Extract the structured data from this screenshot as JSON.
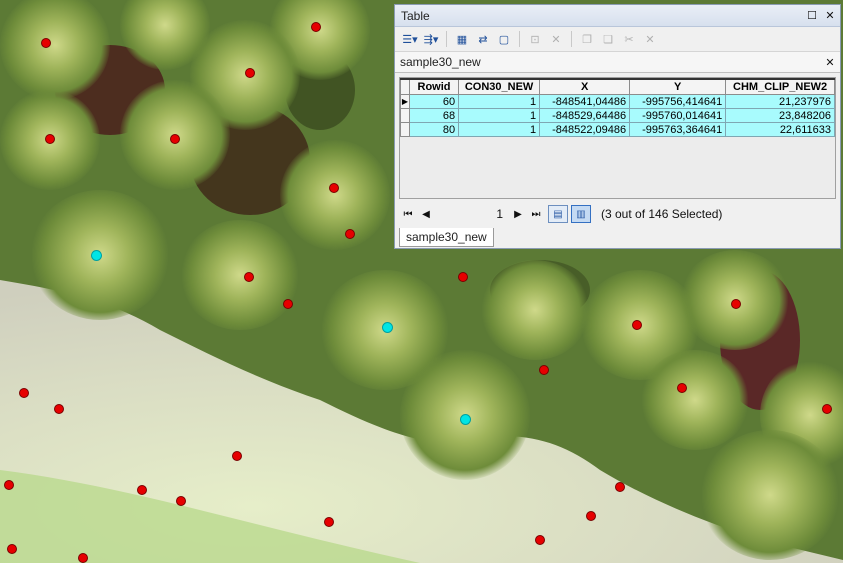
{
  "window": {
    "title": "Table",
    "pin_icon": "restore-icon",
    "close_icon": "close-icon"
  },
  "toolbar": {
    "items": [
      {
        "icon": "table-options-icon",
        "glyph": "☰▾",
        "enabled": true
      },
      {
        "icon": "related-tables-icon",
        "glyph": "⇶▾",
        "enabled": true
      },
      {
        "icon": "select-by-attributes-icon",
        "glyph": "▦",
        "enabled": true
      },
      {
        "icon": "switch-selection-icon",
        "glyph": "⇄",
        "enabled": true
      },
      {
        "icon": "clear-selection-icon",
        "glyph": "▢",
        "enabled": true
      },
      {
        "icon": "zoom-to-selected-icon",
        "glyph": "⊡",
        "enabled": false
      },
      {
        "icon": "delete-selected-icon",
        "glyph": "✕",
        "enabled": false
      },
      {
        "icon": "copy-icon",
        "glyph": "❐",
        "enabled": false
      },
      {
        "icon": "paste-icon",
        "glyph": "❏",
        "enabled": false
      },
      {
        "icon": "cut-icon",
        "glyph": "✂",
        "enabled": false
      },
      {
        "icon": "remove-icon",
        "glyph": "✕",
        "enabled": false
      }
    ]
  },
  "table": {
    "name": "sample30_new",
    "close_icon": "close-icon",
    "columns": [
      "Rowid",
      "CON30_NEW",
      "X",
      "Y",
      "CHM_CLIP_NEW2"
    ],
    "rows": [
      {
        "current": true,
        "cells": [
          "60",
          "1",
          "-848541,04486",
          "-995756,414641",
          "21,237976"
        ]
      },
      {
        "current": false,
        "cells": [
          "68",
          "1",
          "-848529,64486",
          "-995760,014641",
          "23,848206"
        ]
      },
      {
        "current": false,
        "cells": [
          "80",
          "1",
          "-848522,09486",
          "-995763,364641",
          "22,611633"
        ]
      }
    ]
  },
  "navigation": {
    "first_icon": "first-record-icon",
    "prev_icon": "prev-record-icon",
    "next_icon": "next-record-icon",
    "last_icon": "last-record-icon",
    "current_record": "1",
    "show_all_icon": "show-all-records-icon",
    "show_selected_icon": "show-selected-records-icon",
    "selection_text": "(3 out of 146 Selected)"
  },
  "bottom_tab": {
    "label": "sample30_new"
  },
  "colors": {
    "selected_row": "#a8fbfd",
    "point_unselected": "#e60000",
    "point_selected": "#00e5e5"
  }
}
